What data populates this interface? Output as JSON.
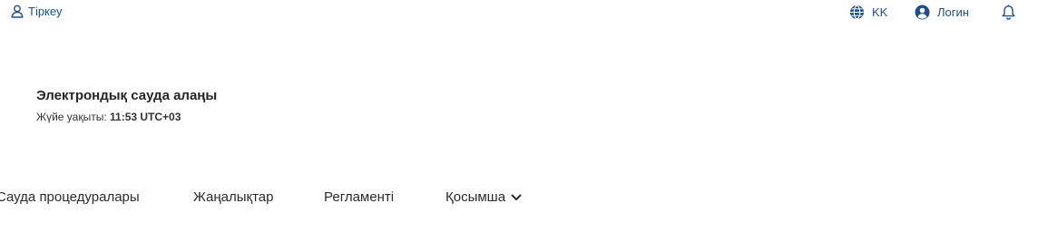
{
  "header": {
    "register_label": "Тіркеу",
    "language_label": "KK",
    "login_label": "Логин"
  },
  "site": {
    "title": "Электрондық сауда алаңы",
    "time_label": "Жүйе уақыты:",
    "time_value": "11:53 UTC+03"
  },
  "nav": {
    "items": [
      {
        "label": "Сауда процедуралары"
      },
      {
        "label": "Жаңалықтар"
      },
      {
        "label": "Регламенті"
      },
      {
        "label": "Қосымша"
      }
    ]
  },
  "colors": {
    "link": "#1d4f8f",
    "text": "#222222"
  },
  "icons": {
    "register": "user-outline-icon",
    "language": "globe-icon",
    "login": "user-circle-icon",
    "notifications": "bell-icon",
    "more": "chevron-down-icon"
  }
}
